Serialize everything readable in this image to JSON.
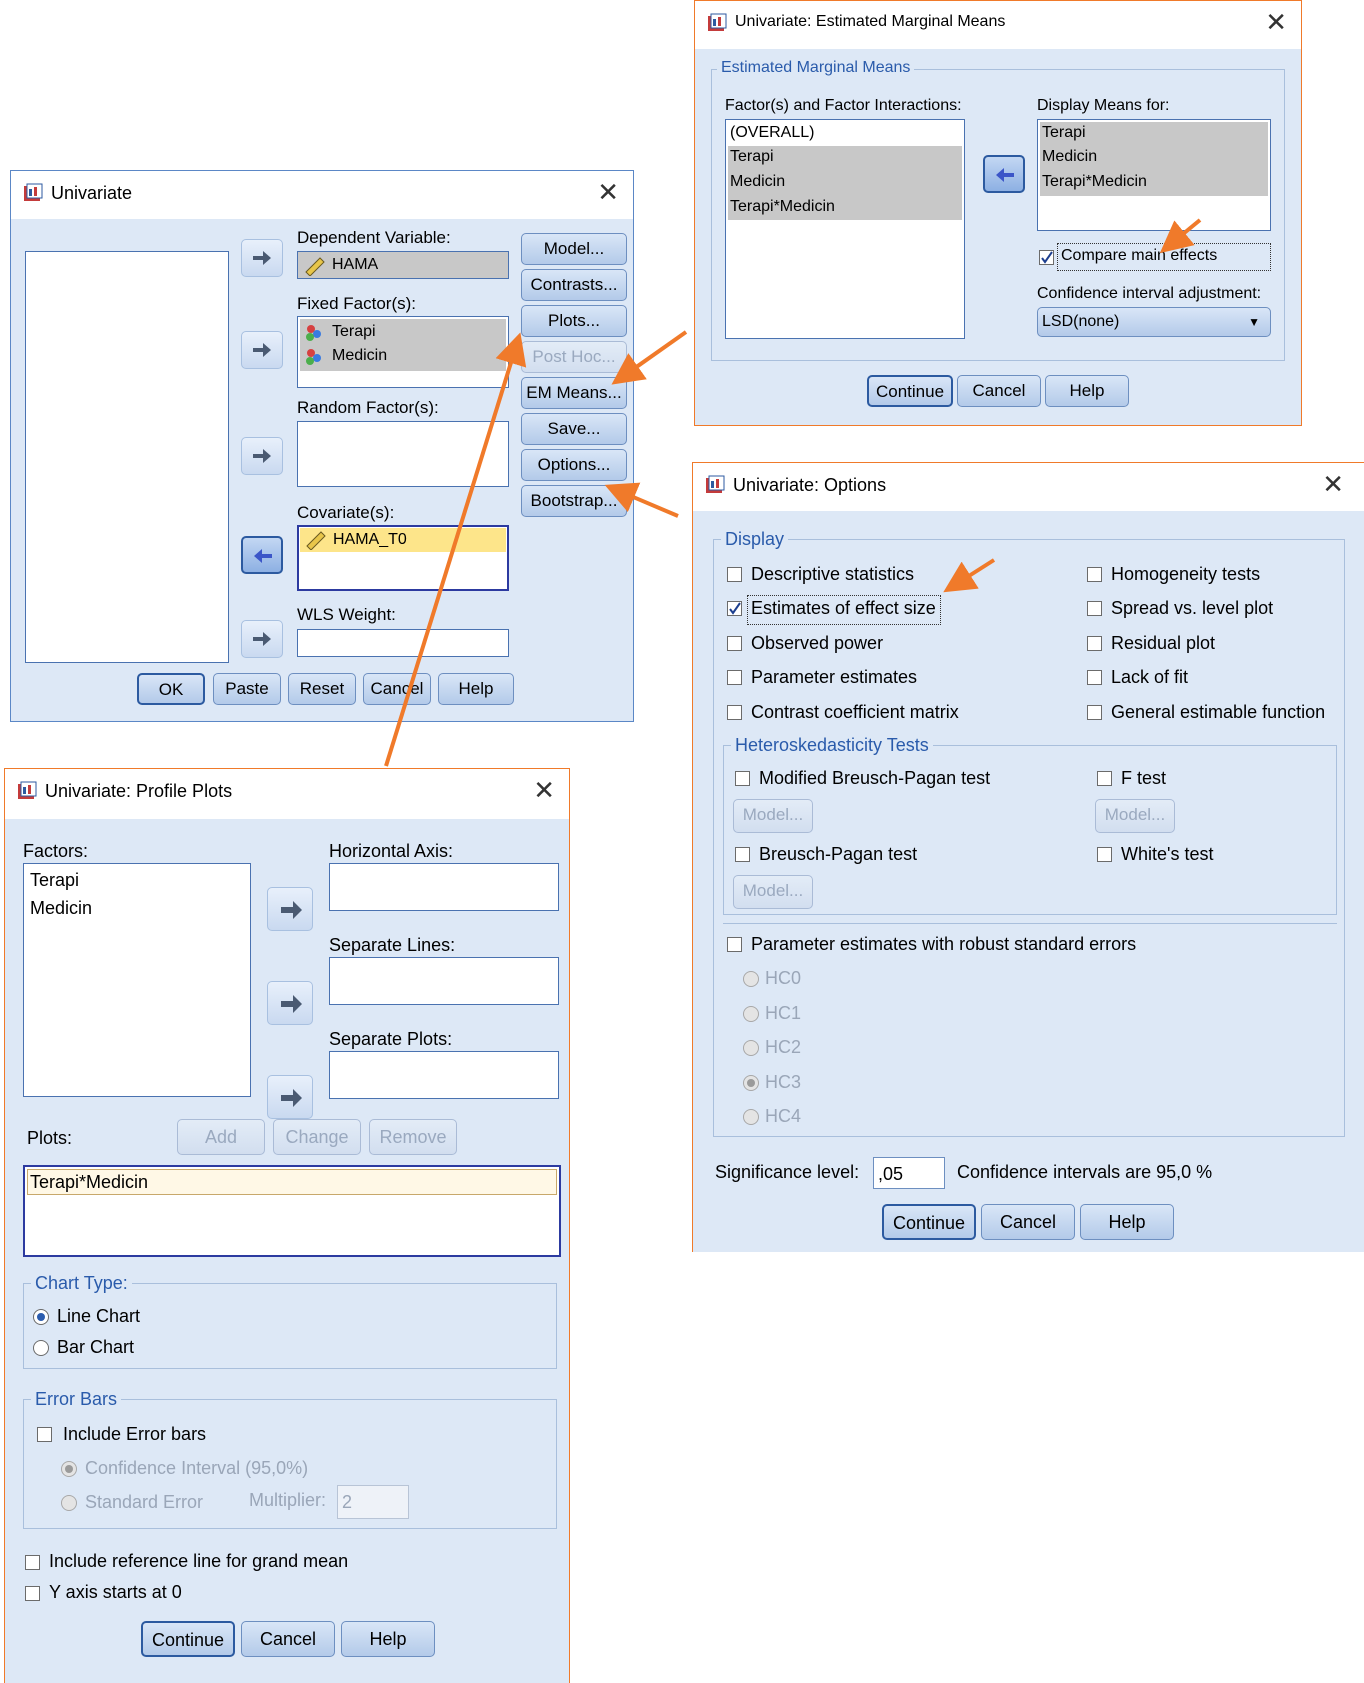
{
  "univariate": {
    "title": "Univariate",
    "dependent_label": "Dependent Variable:",
    "dependent_value": "HAMA",
    "fixed_label": "Fixed Factor(s):",
    "fixed_items": [
      "Terapi",
      "Medicin"
    ],
    "random_label": "Random Factor(s):",
    "covariate_label": "Covariate(s):",
    "covariate_value": "HAMA_T0",
    "wls_label": "WLS Weight:",
    "side_buttons": [
      "Model...",
      "Contrasts...",
      "Plots...",
      "Post Hoc...",
      "EM Means...",
      "Save...",
      "Options...",
      "Bootstrap..."
    ],
    "bottom_buttons": [
      "OK",
      "Paste",
      "Reset",
      "Cancel",
      "Help"
    ]
  },
  "emm": {
    "title": "Univariate: Estimated Marginal Means",
    "group_title": "Estimated Marginal Means",
    "factors_label": "Factor(s) and Factor Interactions:",
    "factors": [
      "(OVERALL)",
      "Terapi",
      "Medicin",
      "Terapi*Medicin"
    ],
    "display_label": "Display Means for:",
    "display_items": [
      "Terapi",
      "Medicin",
      "Terapi*Medicin"
    ],
    "compare_label": "Compare main effects",
    "ci_adj_label": "Confidence interval adjustment:",
    "ci_adj_value": "LSD(none)",
    "buttons": [
      "Continue",
      "Cancel",
      "Help"
    ]
  },
  "options": {
    "title": "Univariate: Options",
    "display_title": "Display",
    "left_checks": [
      "Descriptive statistics",
      "Estimates of effect size",
      "Observed power",
      "Parameter estimates",
      "Contrast coefficient matrix"
    ],
    "right_checks": [
      "Homogeneity tests",
      "Spread vs. level plot",
      "Residual plot",
      "Lack of fit",
      "General estimable function"
    ],
    "hetero_title": "Heteroskedasticity Tests",
    "modified_bp": "Modified Breusch-Pagan test",
    "f_test": "F test",
    "bp_test": "Breusch-Pagan test",
    "whites_test": "White's test",
    "model_btn": "Model...",
    "robust_label": "Parameter estimates with robust standard errors",
    "hc": [
      "HC0",
      "HC1",
      "HC2",
      "HC3",
      "HC4"
    ],
    "sig_label": "Significance level:",
    "sig_value": ",05",
    "ci_text": "Confidence intervals are 95,0 %",
    "buttons": [
      "Continue",
      "Cancel",
      "Help"
    ]
  },
  "profile": {
    "title": "Univariate: Profile Plots",
    "factors_label": "Factors:",
    "factors": [
      "Terapi",
      "Medicin"
    ],
    "horizontal_label": "Horizontal Axis:",
    "sep_lines_label": "Separate Lines:",
    "sep_plots_label": "Separate Plots:",
    "plots_label": "Plots:",
    "add": "Add",
    "change": "Change",
    "remove": "Remove",
    "plot_item": "Terapi*Medicin",
    "chart_type_title": "Chart Type:",
    "line_chart": "Line Chart",
    "bar_chart": "Bar Chart",
    "error_bars_title": "Error Bars",
    "include_error": "Include Error bars",
    "ci_option": "Confidence Interval (95,0%)",
    "se_option": "Standard Error",
    "multiplier_label": "Multiplier:",
    "multiplier_value": "2",
    "ref_line": "Include reference line for grand mean",
    "y_axis": "Y axis starts at 0",
    "buttons": [
      "Continue",
      "Cancel",
      "Help"
    ]
  },
  "colors": {
    "annotation_arrow": "#f07a2a",
    "dialog_bg": "#dde8f6",
    "group_title": "#2a5bab"
  }
}
